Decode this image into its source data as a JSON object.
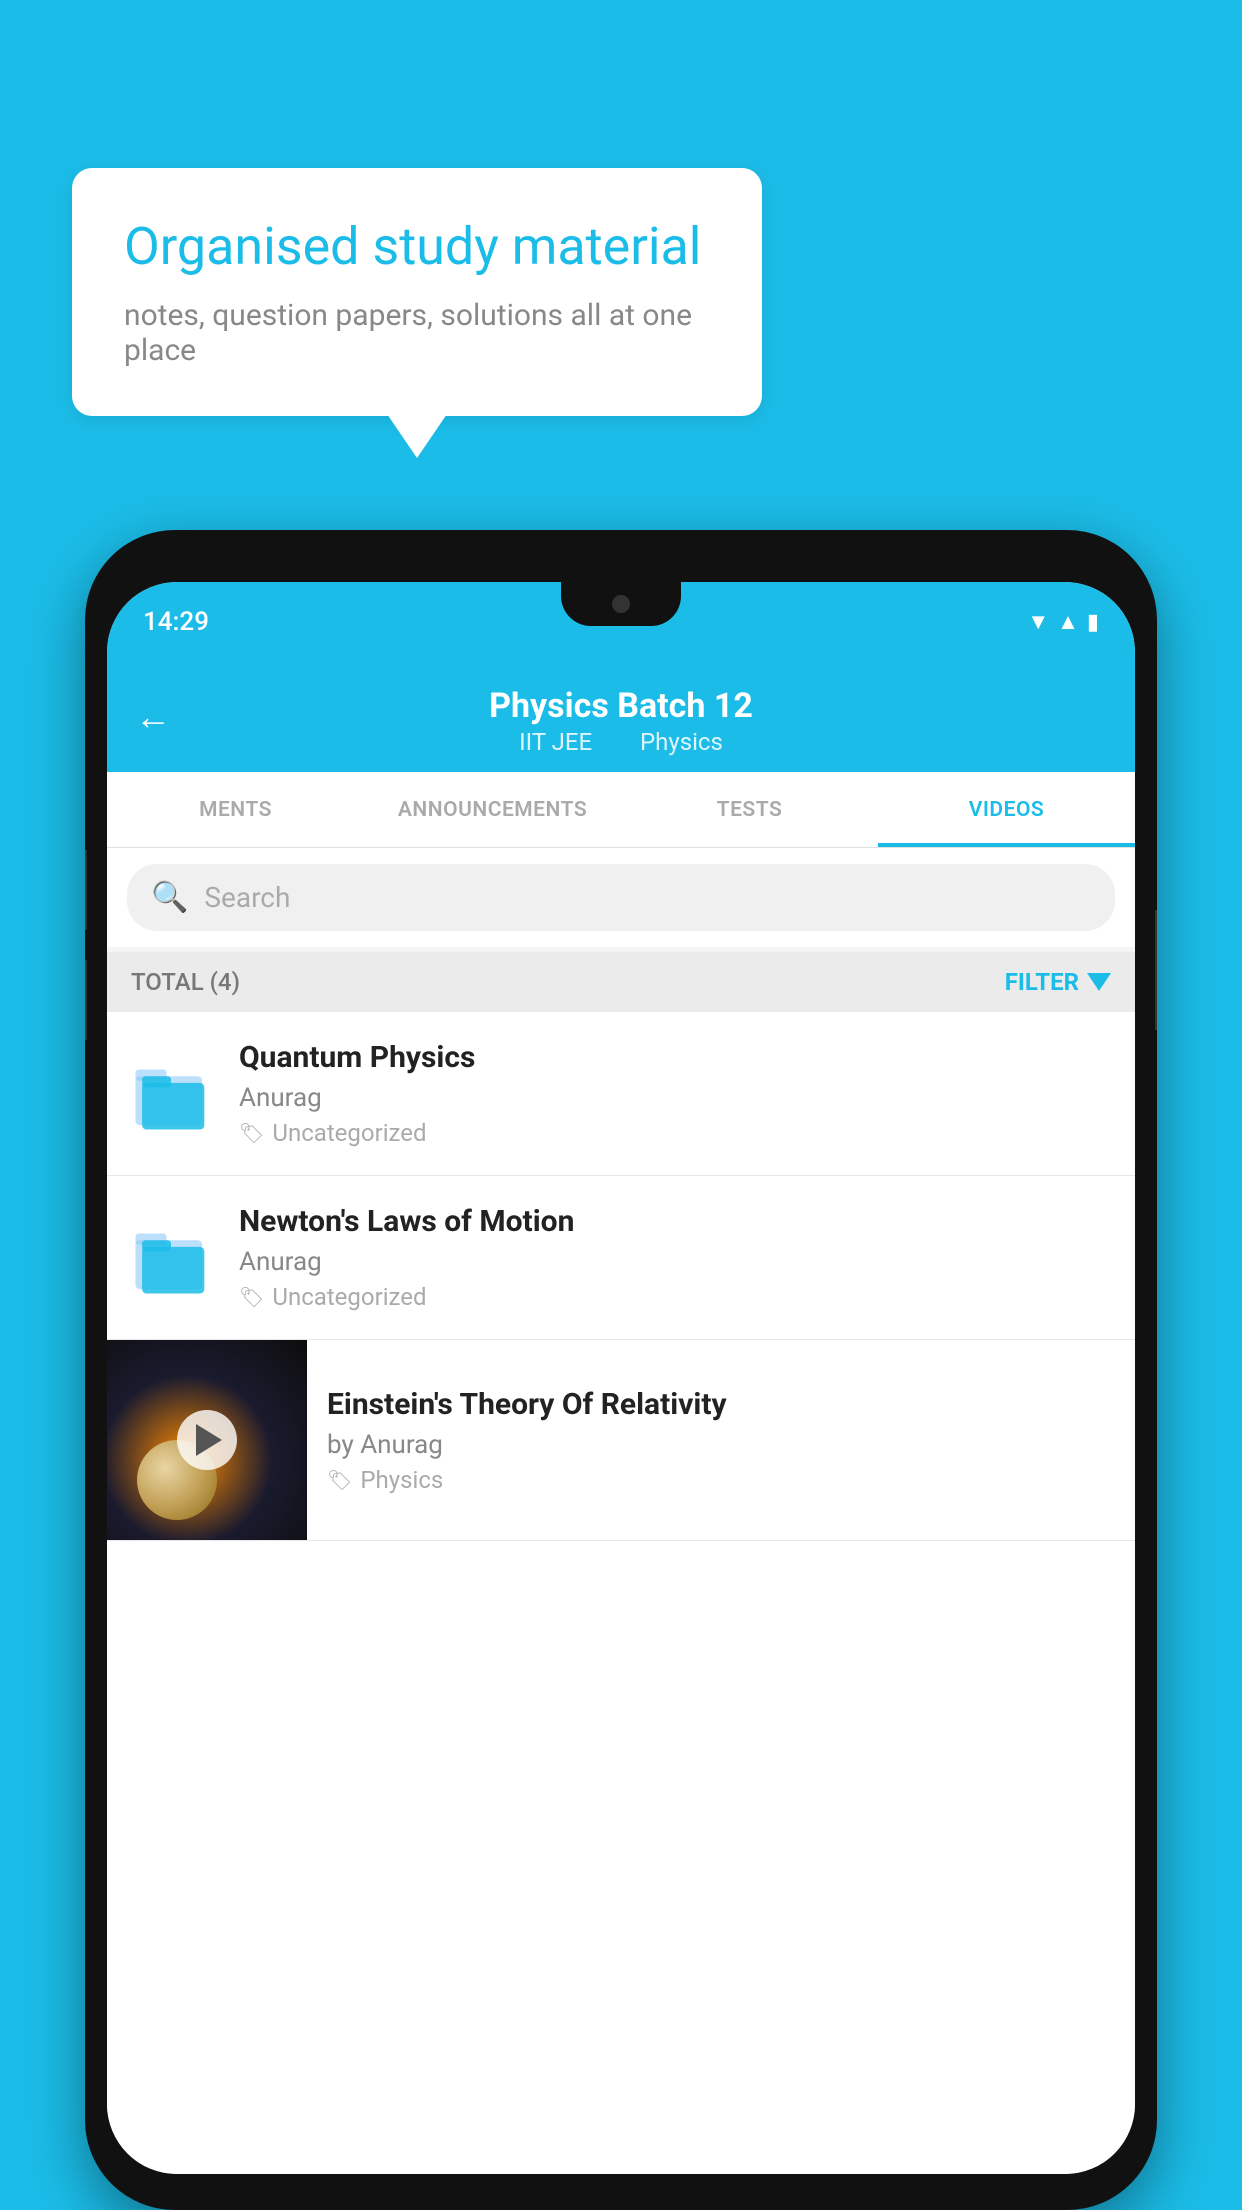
{
  "background_color": "#1BBDE8",
  "bubble": {
    "title": "Organised study material",
    "subtitle": "notes, question papers, solutions all at one place"
  },
  "status_bar": {
    "time": "14:29",
    "icons": [
      "wifi",
      "signal",
      "battery"
    ]
  },
  "header": {
    "title": "Physics Batch 12",
    "tag1": "IIT JEE",
    "tag2": "Physics",
    "back_label": "←"
  },
  "tabs": [
    {
      "label": "MENTS",
      "active": false
    },
    {
      "label": "ANNOUNCEMENTS",
      "active": false
    },
    {
      "label": "TESTS",
      "active": false
    },
    {
      "label": "VIDEOS",
      "active": true
    }
  ],
  "search": {
    "placeholder": "Search"
  },
  "filter": {
    "total_label": "TOTAL (4)",
    "filter_label": "FILTER"
  },
  "videos": [
    {
      "title": "Quantum Physics",
      "author": "Anurag",
      "tag": "Uncategorized",
      "has_thumb": false
    },
    {
      "title": "Newton's Laws of Motion",
      "author": "Anurag",
      "tag": "Uncategorized",
      "has_thumb": false
    },
    {
      "title": "Einstein's Theory Of Relativity",
      "author": "by Anurag",
      "tag": "Physics",
      "has_thumb": true
    }
  ]
}
